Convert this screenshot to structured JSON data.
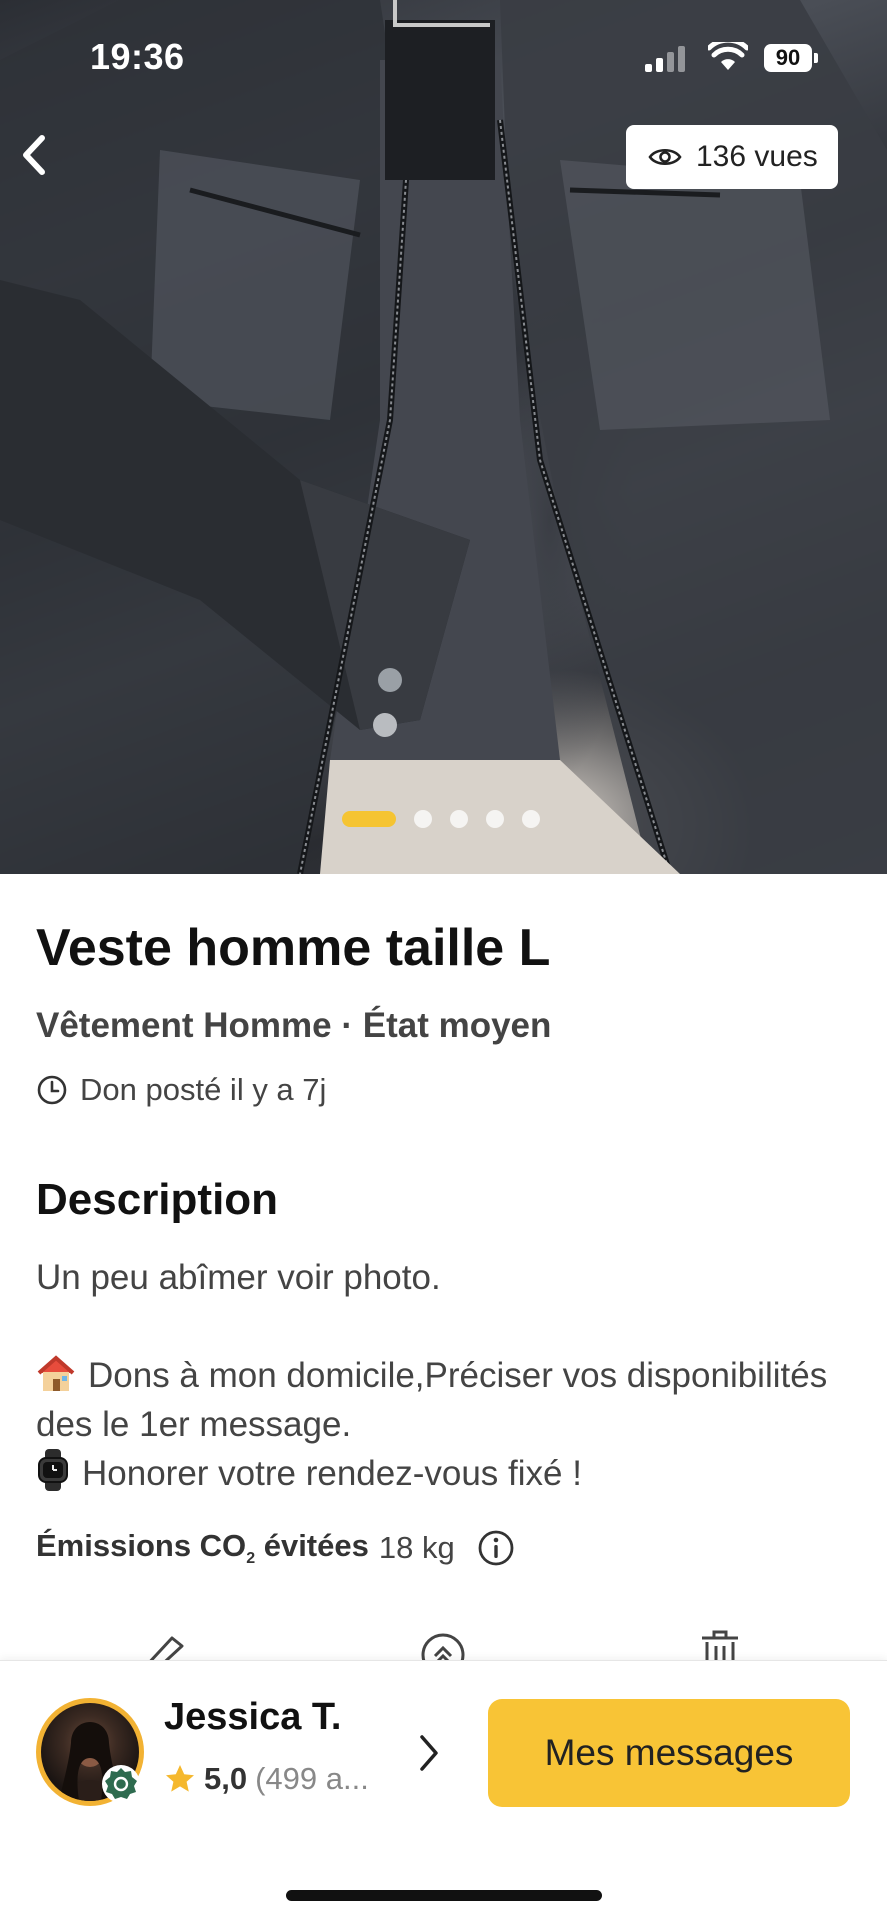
{
  "status_bar": {
    "time": "19:36",
    "battery": "90"
  },
  "header": {
    "views": "136 vues"
  },
  "gallery": {
    "image_count": 5,
    "active_index": 0,
    "accent_color": "#f5c432"
  },
  "item": {
    "title": "Veste homme taille L",
    "subtitle": "Vêtement Homme · État moyen",
    "posted": "Don posté il y a 7j"
  },
  "description": {
    "heading": "Description",
    "line1": "Un peu abîmer voir photo.",
    "line2": "Dons à mon domicile,Préciser vos disponibilités des le 1er message.",
    "line3": "Honorer votre rendez-vous fixé !"
  },
  "co2": {
    "label_pre": "Émissions CO",
    "label_sub": "2",
    "label_post": " évitées",
    "value": "18 kg"
  },
  "seller": {
    "name": "Jessica T.",
    "rating": "5,0",
    "reviews": "(499 a..."
  },
  "cta": {
    "label": "Mes messages",
    "color": "#f8c436"
  }
}
